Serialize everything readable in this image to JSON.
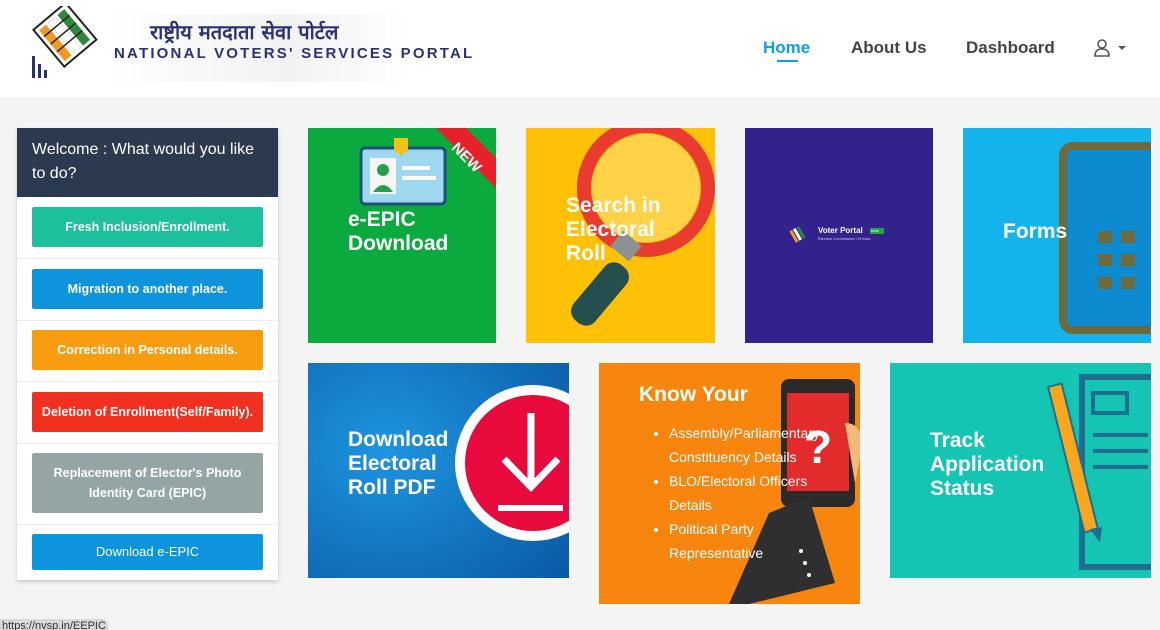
{
  "header": {
    "title_hindi": "राष्ट्रीय मतदाता सेवा पोर्टल",
    "title_english": "NATIONAL VOTERS' SERVICES PORTAL"
  },
  "nav": {
    "home": "Home",
    "about": "About Us",
    "dashboard": "Dashboard"
  },
  "panel": {
    "heading": "Welcome : What would you like to do?",
    "buttons": [
      {
        "label": "Fresh Inclusion/Enrollment.",
        "color": "#1cc09a"
      },
      {
        "label": "Migration to another place.",
        "color": "#0d94dc"
      },
      {
        "label": "Correction in Personal details.",
        "color": "#f89d10"
      },
      {
        "label": "Deletion of Enrollment(Self/Family).",
        "color": "#f0311f"
      },
      {
        "label": "Replacement of Elector's Photo Identity Card (EPIC)",
        "color": "#95a5a6"
      },
      {
        "label": "Download e-EPIC",
        "color": "#0d94dc"
      }
    ]
  },
  "tiles": {
    "epic": {
      "label": "e-EPIC\nDownload",
      "badge": "NEW",
      "color": "#0aaa3e"
    },
    "search": {
      "label": "Search in\nElectoral\nRoll",
      "color": "#ffc107"
    },
    "voter_portal": {
      "label": "Voter Portal",
      "badge": "beta",
      "sub": "Election Commission Of India",
      "color": "#33218c"
    },
    "forms": {
      "label": "Forms",
      "color": "#14b3eb"
    },
    "download_roll": {
      "label": "Download\nElectoral\nRoll PDF",
      "color": "#1378c6"
    },
    "know": {
      "label": "Know Your",
      "items": [
        "Assembly/Parliamentary Constituency Details",
        "BLO/Electoral Officers Details",
        "Political Party Representative"
      ],
      "color": "#f8860e"
    },
    "track": {
      "label": "Track\nApplication\nStatus",
      "color": "#13c5b2"
    }
  },
  "status_bar": {
    "url": "https://nvsp.in/EEPIC"
  }
}
